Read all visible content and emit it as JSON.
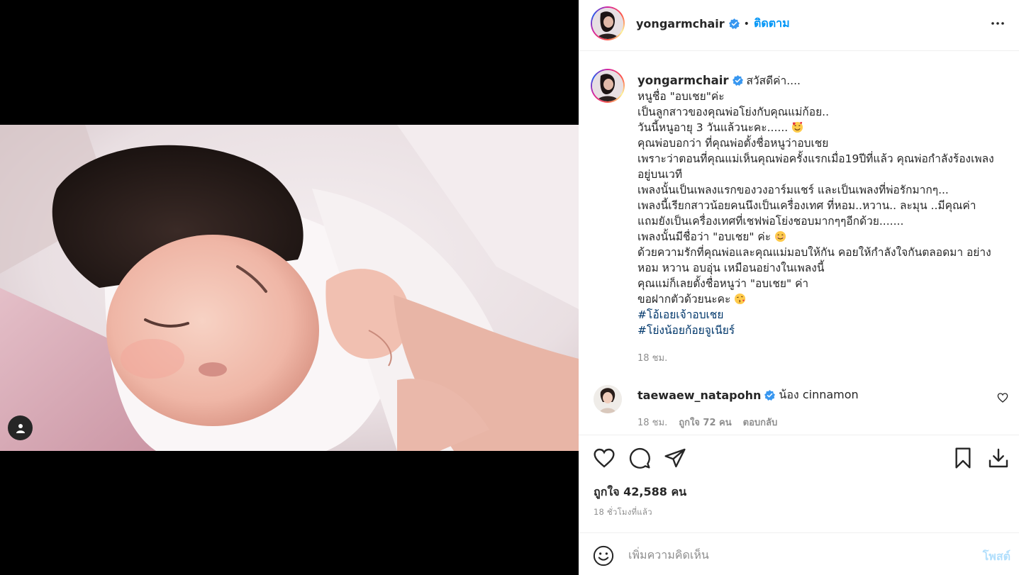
{
  "header": {
    "username": "yongarmchair",
    "separator": "•",
    "follow_label": "ติดตาม"
  },
  "caption": {
    "username": "yongarmchair",
    "lines": [
      "สวัสดีค่า....",
      "หนูชื่อ \"อบเชย\"ค่ะ",
      "เป็นลูกสาวของคุณพ่อโย่งกับคุณแม่ก้อย..",
      "วันนี้หนูอายุ 3 วันแล้วนะคะ......",
      "คุณพ่อบอกว่า ที่คุณพ่อตั้งชื่อหนูว่าอบเชย",
      "เพราะว่าตอนที่คุณแม่เห็นคุณพ่อครั้งแรกเมื่อ19ปีที่แล้ว คุณพ่อกำลังร้องเพลง",
      "อยู่บนเวที",
      "เพลงนั้นเป็นเพลงแรกของวงอาร์มแชร์ และเป็นเพลงที่พ่อรักมากๆ...",
      "เพลงนี้เรียกสาวน้อยคนนึงเป็นเครื่องเทศ ที่หอม..หวาน.. ละมุน ..มีคุณค่า",
      "แถมยังเป็นเครื่องเทศที่เชฟพ่อโย่งชอบมากๆๆอีกด้วย.......",
      "เพลงนั้นมีชื่อว่า \"อบเชย\" ค่ะ",
      "ด้วยความรักที่คุณพ่อและคุณแม่มอบให้กัน คอยให้กำลังใจกันตลอดมา อย่าง",
      "หอม หวาน อบอุ่น เหมือนอย่างในเพลงนี้",
      "คุณแม่ก็เลยตั้งชื่อหนูว่า \"อบเชย\" ค่า",
      "ขอฝากตัวด้วยนะคะ"
    ],
    "hashtags": [
      "#โอ้เอยเจ้าอบเชย",
      "#โย่งน้อยก้อยจูเนียร์"
    ],
    "time": "18 ชม."
  },
  "comment": {
    "username": "taewaew_natapohn",
    "text": "น้อง cinnamon",
    "time": "18 ชม.",
    "likes": "ถูกใจ 72 คน",
    "reply": "ตอบกลับ"
  },
  "post": {
    "likes": "ถูกใจ 42,588 คน",
    "ago": "18 ชั่วโมงที่แล้ว"
  },
  "add_comment": {
    "placeholder": "เพิ่มความคิดเห็น",
    "post_label": "โพสต์"
  },
  "colors": {
    "link_blue": "#0095f6",
    "hashtag": "#00376b",
    "muted": "#8e8e8e",
    "post_disabled": "#b2dffc"
  }
}
